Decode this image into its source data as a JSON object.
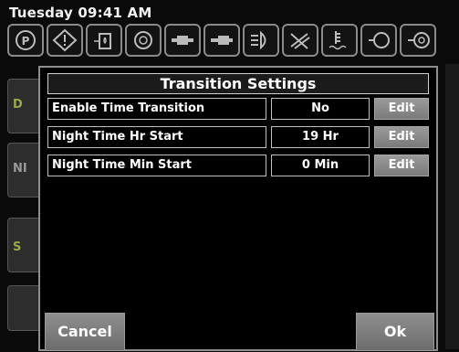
{
  "status": {
    "datetime": "Tuesday 09:41 AM"
  },
  "telltales": [
    "parking-brake-icon",
    "warning-icon",
    "fuel-filter-icon",
    "engine-icon",
    "battery-connector-icon",
    "cable-icon",
    "headlamp-icon",
    "wiper-icon",
    "coolant-icon",
    "fluid-level-icon",
    "filter-icon"
  ],
  "background": {
    "button_1_label": "D",
    "button_2_label": "NI",
    "button_3_label": "S"
  },
  "dialog": {
    "title": "Transition Settings",
    "rows": [
      {
        "label": "Enable Time Transition",
        "value": "No",
        "action": "Edit"
      },
      {
        "label": "Night Time Hr Start",
        "value": "19 Hr",
        "action": "Edit"
      },
      {
        "label": "Night Time Min Start",
        "value": "0 Min",
        "action": "Edit"
      }
    ],
    "cancel_label": "Cancel",
    "ok_label": "Ok"
  },
  "colors": {
    "background": "#000000",
    "button_gray": "#8a8a8a",
    "border_light": "#bfbfbf",
    "accent_green": "#9aa84a"
  }
}
